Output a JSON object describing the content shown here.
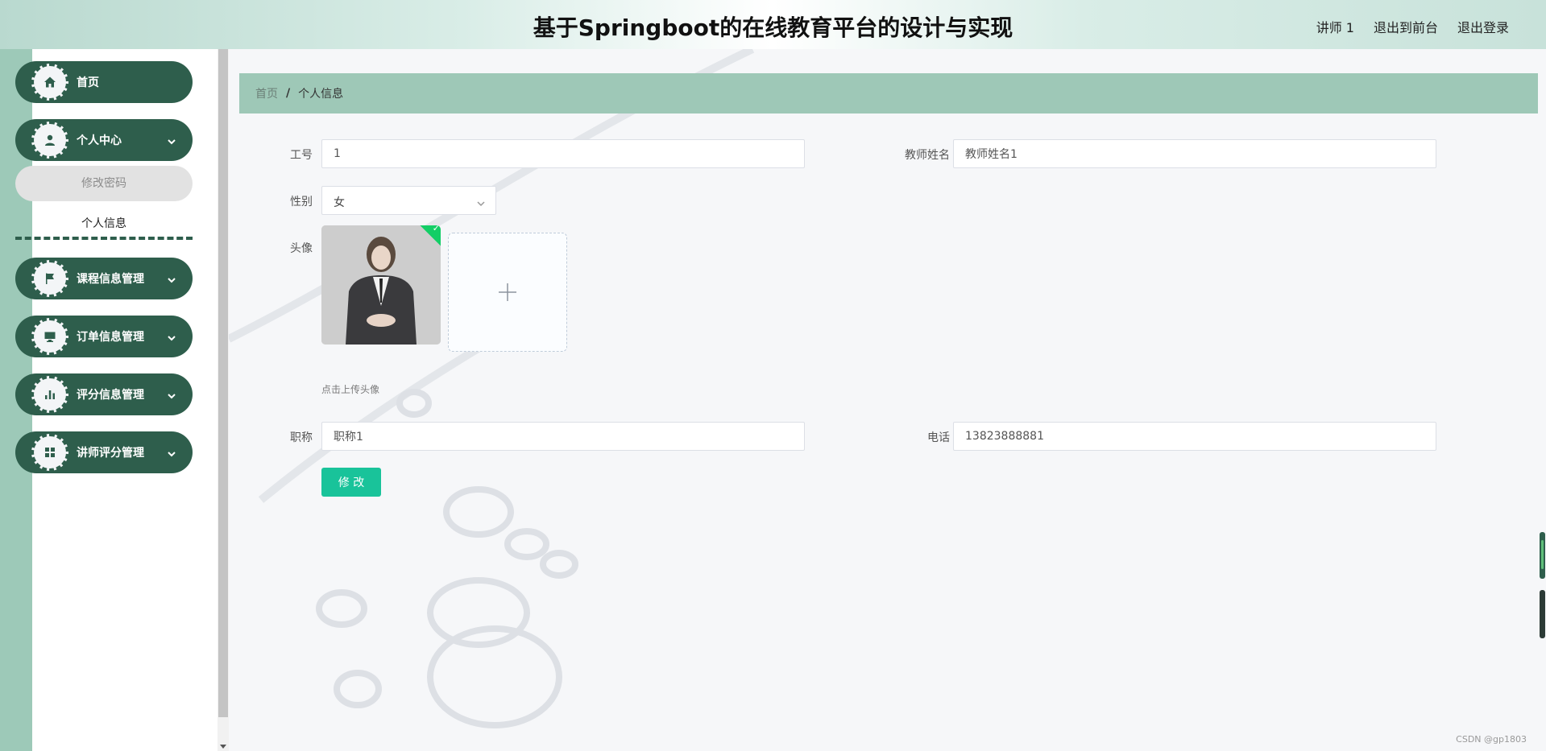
{
  "header": {
    "title": "基于Springboot的在线教育平台的设计与实现",
    "links": [
      "讲师 1",
      "退出到前台",
      "退出登录"
    ]
  },
  "sidebar": {
    "items": [
      {
        "label": "首页",
        "icon": "home-icon"
      },
      {
        "label": "个人中心",
        "icon": "user-icon"
      },
      {
        "label": "课程信息管理",
        "icon": "flag-icon"
      },
      {
        "label": "订单信息管理",
        "icon": "monitor-icon"
      },
      {
        "label": "评分信息管理",
        "icon": "bar-chart-icon"
      },
      {
        "label": "讲师评分管理",
        "icon": "grid-icon"
      }
    ],
    "sub_items": [
      "修改密码",
      "个人信息"
    ],
    "colors": {
      "pill": "#2e5e4c",
      "strip": "#9dc9b8"
    }
  },
  "breadcrumb": {
    "home": "首页",
    "separator": "/",
    "current": "个人信息"
  },
  "form": {
    "employee_id": {
      "label": "工号",
      "value": "1"
    },
    "teacher_name": {
      "label": "教师姓名",
      "value": "教师姓名1"
    },
    "gender": {
      "label": "性别",
      "value": "女"
    },
    "avatar": {
      "label": "头像",
      "tip": "点击上传头像"
    },
    "title": {
      "label": "职称",
      "value": "职称1"
    },
    "phone": {
      "label": "电话",
      "value": "13823888881"
    },
    "submit_label": "修 改"
  },
  "watermark": "CSDN @gp1803",
  "colors": {
    "accent": "#19c39a",
    "breadcrumb_bg": "#9ec8b7"
  }
}
